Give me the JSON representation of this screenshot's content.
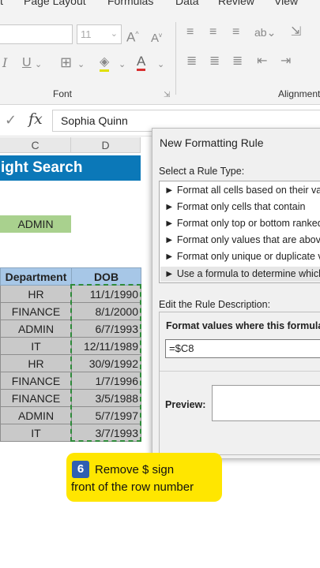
{
  "ribbon": {
    "tabs": [
      "t",
      "Page Layout",
      "Formulas",
      "Data",
      "Review",
      "View"
    ],
    "font_size": "11",
    "font_group_label": "Font",
    "alignment_group_label": "Alignment"
  },
  "formula_bar": {
    "fx": "fx",
    "value": "Sophia Quinn"
  },
  "sheet": {
    "columns": [
      "C",
      "D"
    ],
    "title": "ight Search",
    "admin_value": "ADMIN",
    "table": {
      "headers": [
        "Department",
        "DOB"
      ],
      "rows": [
        [
          "HR",
          "11/1/1990"
        ],
        [
          "FINANCE",
          "8/1/2000"
        ],
        [
          "ADMIN",
          "6/7/1993"
        ],
        [
          "IT",
          "12/11/1989"
        ],
        [
          "HR",
          "30/9/1992"
        ],
        [
          "FINANCE",
          "1/7/1996"
        ],
        [
          "FINANCE",
          "3/5/1988"
        ],
        [
          "ADMIN",
          "5/7/1997"
        ],
        [
          "IT",
          "3/7/1993"
        ]
      ]
    }
  },
  "dialog": {
    "title": "New Formatting Rule",
    "select_label": "Select a Rule Type:",
    "rules": [
      "► Format all cells based on their valu",
      "► Format only cells that contain",
      "► Format only top or bottom ranked",
      "► Format only values that are above",
      "► Format only unique or duplicate va",
      "► Use a formula to determine which"
    ],
    "edit_label": "Edit the Rule Description:",
    "format_label": "Format values where this formula i",
    "formula_value": "=$C8",
    "preview_label": "Preview:"
  },
  "callout": {
    "step": "6",
    "line1": "Remove $ sign",
    "line2": "front of the row number",
    "color": "#ffe600"
  }
}
